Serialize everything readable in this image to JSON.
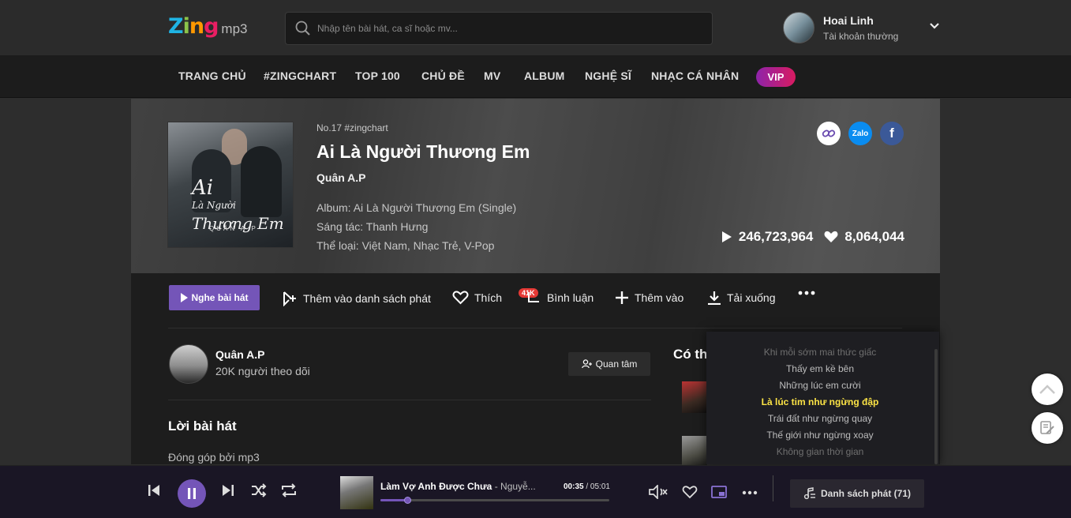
{
  "header": {
    "logo_zing": "Zing",
    "logo_mp3": "mp3",
    "search_placeholder": "Nhập tên bài hát, ca sĩ hoặc mv...",
    "user_name": "Hoai Linh",
    "user_type": "Tài khoản thường"
  },
  "nav": {
    "items": [
      "TRANG CHỦ",
      "#ZINGCHART",
      "TOP 100",
      "CHỦ ĐỀ",
      "MV",
      "ALBUM",
      "NGHỆ SĨ",
      "NHẠC CÁ NHÂN"
    ],
    "vip": "VIP"
  },
  "song": {
    "rank": "No.17 #zingchart",
    "title": "Ai Là Người Thương Em",
    "artist": "Quân A.P",
    "album": "Album: Ai Là Người Thương Em (Single)",
    "composer": "Sáng tác: Thanh Hưng",
    "genre": "Thể loại: Việt Nam, Nhạc Trẻ, V-Pop",
    "plays": "246,723,964",
    "likes": "8,064,044",
    "cover_title_main": "Ai",
    "cover_title_sub": "Là Người",
    "cover_title_end": "Thương Em",
    "cover_artist": "QUÂN A.P"
  },
  "share": {
    "zalo": "Zalo",
    "facebook": "f"
  },
  "actions": {
    "play": "Nghe bài hát",
    "add_playlist": "Thêm vào danh sách phát",
    "like": "Thích",
    "comment_badge": "41K",
    "comment": "Bình luận",
    "add_to": "Thêm vào",
    "download": "Tải xuống"
  },
  "artist_card": {
    "name": "Quân A.P",
    "followers": "20K người theo dõi",
    "follow_btn": "Quan tâm"
  },
  "lyrics_section": {
    "heading": "Lời bài hát",
    "contributed": "Đóng góp bởi mp3"
  },
  "suggest": {
    "heading": "Có th"
  },
  "karaoke": {
    "lines": [
      "Khi mỗi sớm mai thức giấc",
      "Thấy em kề bên",
      "Những lúc em cười",
      "Là lúc tim như ngừng đập",
      "Trái đất như ngừng quay",
      "Thế giới như ngừng xoay",
      "Không gian thời gian"
    ],
    "active_index": 3
  },
  "player": {
    "title": "Làm Vợ Anh Được Chưa",
    "artist": " - Nguyễ...",
    "current": "00:35",
    "total": "05:01",
    "progress_fraction": 0.116,
    "playlist": "Danh sách phát (71)"
  },
  "colors": {
    "accent": "#7455b8",
    "lyric_active": "#fbe345",
    "badge": "#e53935"
  }
}
